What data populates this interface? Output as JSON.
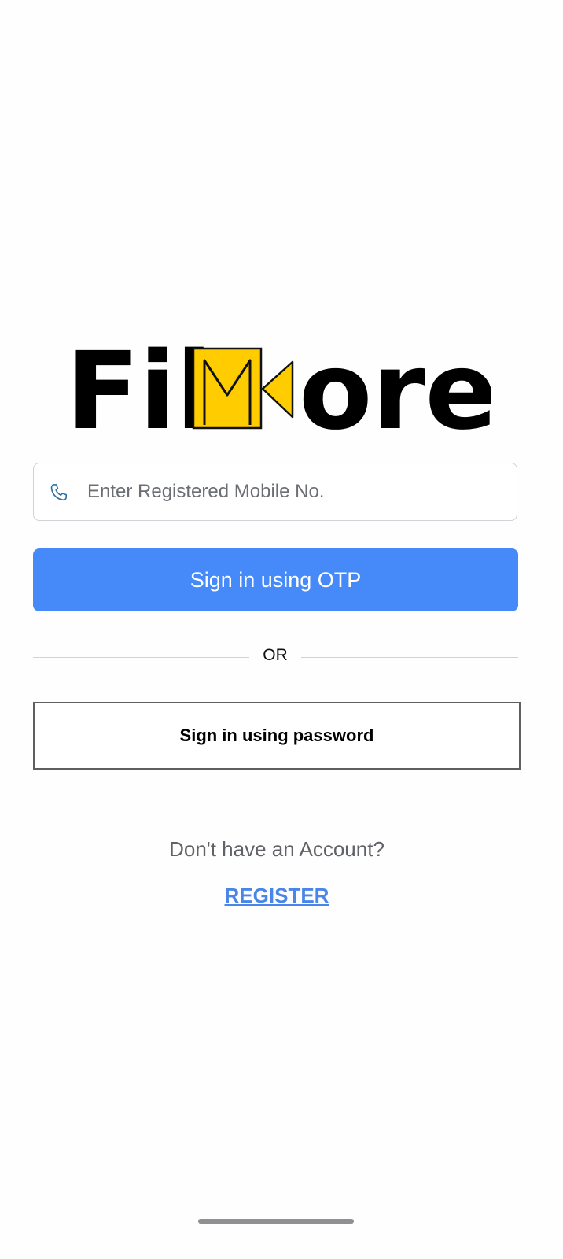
{
  "app": {
    "logo_text": {
      "part1": "Fil",
      "part2": "ore"
    },
    "logo_colors": {
      "dark": "#000000",
      "accent": "#ffcc00"
    }
  },
  "login": {
    "mobile_input": {
      "placeholder": "Enter Registered Mobile No.",
      "value": ""
    },
    "otp_button_label": "Sign in using OTP",
    "divider_text": "OR",
    "password_button_label": "Sign in using password"
  },
  "register": {
    "prompt": "Don't have an Account?",
    "link_label": "REGISTER"
  },
  "icons": {
    "phone": "phone-icon"
  },
  "colors": {
    "primary": "#4689f9",
    "link": "#4a86e8",
    "border": "#cfd2d6"
  }
}
